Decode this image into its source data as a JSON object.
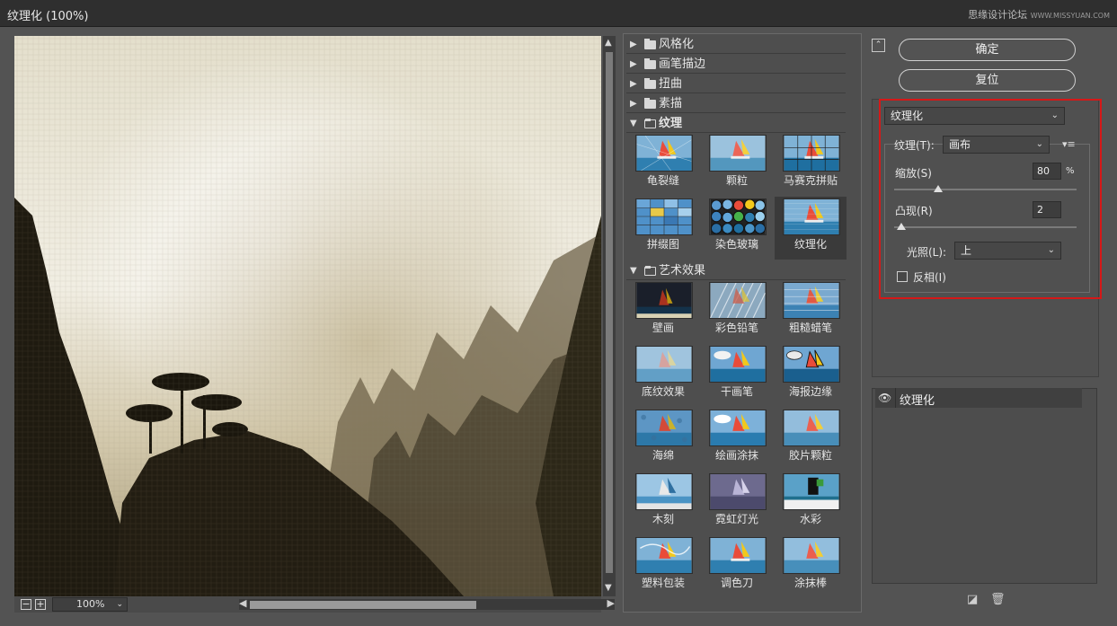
{
  "window": {
    "title": "纹理化 (100%)",
    "watermark": "思缘设计论坛",
    "watermark_url": "WWW.MISSYUAN.COM"
  },
  "preview": {
    "zoom": "100%",
    "zoom_out": "−",
    "zoom_in": "+"
  },
  "gallery": {
    "categories": [
      {
        "label": "风格化",
        "open": false
      },
      {
        "label": "画笔描边",
        "open": false
      },
      {
        "label": "扭曲",
        "open": false
      },
      {
        "label": "素描",
        "open": false
      },
      {
        "label": "纹理",
        "open": true
      },
      {
        "label": "艺术效果",
        "open": true
      }
    ],
    "texture_filters": [
      "龟裂缝",
      "颗粒",
      "马赛克拼贴",
      "拼缀图",
      "染色玻璃",
      "纹理化"
    ],
    "art_filters": [
      "壁画",
      "彩色铅笔",
      "粗糙蜡笔",
      "底纹效果",
      "干画笔",
      "海报边缘",
      "海绵",
      "绘画涂抹",
      "胶片颗粒",
      "木刻",
      "霓虹灯光",
      "水彩",
      "塑料包装",
      "调色刀",
      "涂抹棒"
    ],
    "selected": "纹理化"
  },
  "actions": {
    "ok": "确定",
    "reset": "复位"
  },
  "settings": {
    "filter_select": "纹理化",
    "texture_label": "纹理(T):",
    "texture_value": "画布",
    "scaling_label": "缩放(S)",
    "scaling_value": "80",
    "scaling_unit": "%",
    "scaling_fraction": 0.24,
    "relief_label": "凸现(R)",
    "relief_value": "2",
    "relief_fraction": 0.04,
    "light_label": "光照(L):",
    "light_value": "上",
    "invert_label": "反相(I)",
    "invert_checked": false,
    "highlight_color": "#d61818"
  },
  "layers": {
    "items": [
      {
        "name": "纹理化",
        "visible": true
      }
    ]
  }
}
